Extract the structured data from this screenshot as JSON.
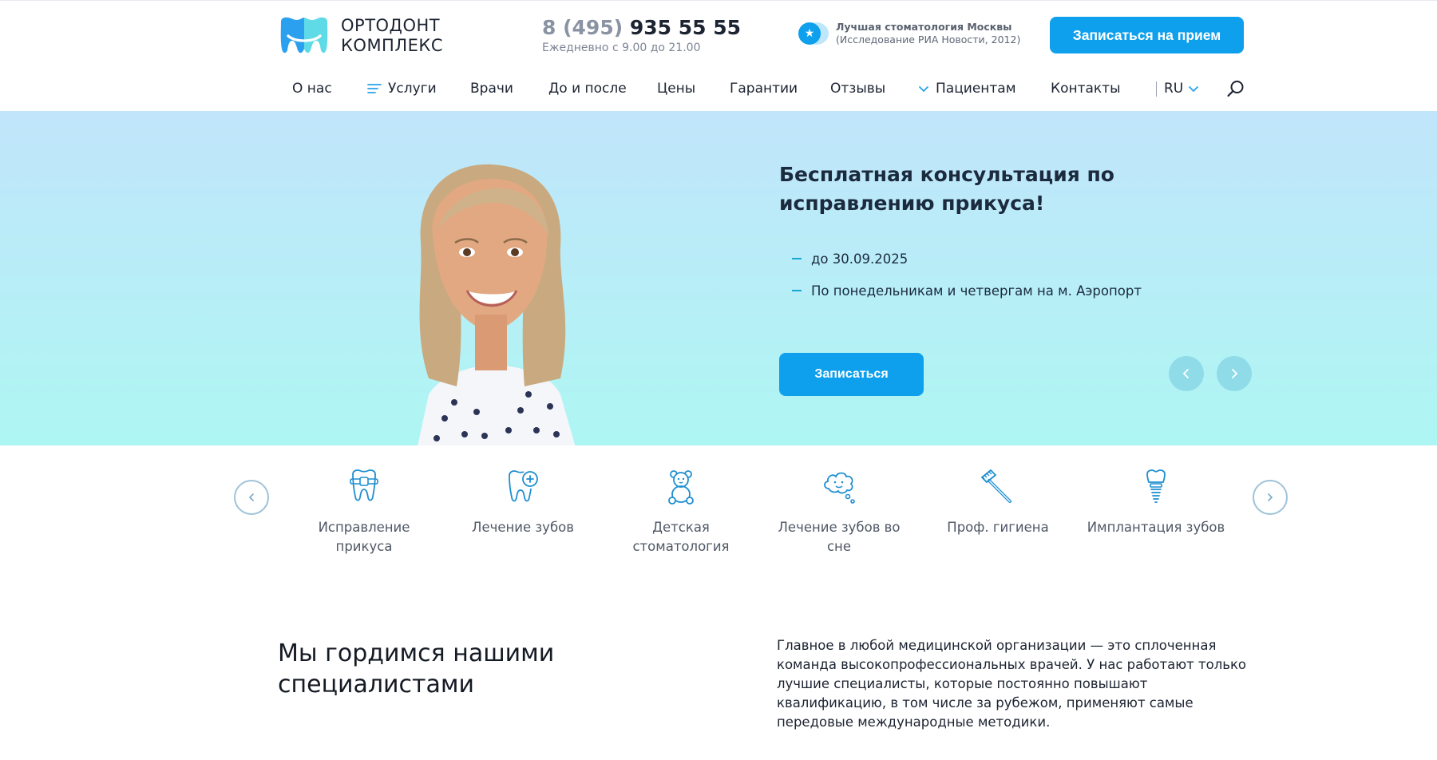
{
  "header": {
    "logo_line1": "ОРТОДОНТ",
    "logo_line2": "КОМПЛЕКС",
    "phone_code": "8 (495)",
    "phone_number": "935 55 55",
    "hours": "Ежедневно с 9.00 до 21.00",
    "award_title": "Лучшая стоматология Москвы",
    "award_source": "(Исследование РИА Новости, 2012)",
    "cta_label": "Записаться на прием",
    "brand_color": "#0ea0ec"
  },
  "nav": {
    "items": [
      {
        "label": "О нас",
        "icon": null
      },
      {
        "label": "Услуги",
        "icon": "menu-lines-icon"
      },
      {
        "label": "Врачи",
        "icon": null
      },
      {
        "label": "До и после",
        "icon": null
      },
      {
        "label": "Цены",
        "icon": null
      },
      {
        "label": "Гарантии",
        "icon": null
      },
      {
        "label": "Отзывы",
        "icon": null
      },
      {
        "label": "Пациентам",
        "icon": "chevron-down-icon"
      },
      {
        "label": "Контакты",
        "icon": null
      }
    ],
    "language": "RU",
    "search_icon": "search-icon"
  },
  "hero": {
    "title": "Бесплатная консультация по исправлению прикуса!",
    "points": [
      "до 30.09.2025",
      "По понедельникам и четвергам на м. Аэропорт"
    ],
    "button_label": "Записаться",
    "prev_icon": "chevron-left-icon",
    "next_icon": "chevron-right-icon"
  },
  "services": {
    "items": [
      {
        "label": "Исправление прикуса",
        "icon": "braces-tooth-icon"
      },
      {
        "label": "Лечение зубов",
        "icon": "tooth-plus-icon"
      },
      {
        "label": "Детская стоматология",
        "icon": "teddy-bear-icon"
      },
      {
        "label": "Лечение зубов во сне",
        "icon": "sleep-cloud-icon"
      },
      {
        "label": "Проф. гигиена",
        "icon": "toothbrush-icon"
      },
      {
        "label": "Имплантация зубов",
        "icon": "implant-icon"
      }
    ]
  },
  "specialists": {
    "title": "Мы гордимся нашими специалистами",
    "text": "Главное в любой медицинской организации — это сплоченная команда высокопрофессиональных врачей. У нас работают только лучшие специалисты, которые постоянно повышают квалификацию, в том числе за рубежом, применяют самые передовые международные методики."
  }
}
